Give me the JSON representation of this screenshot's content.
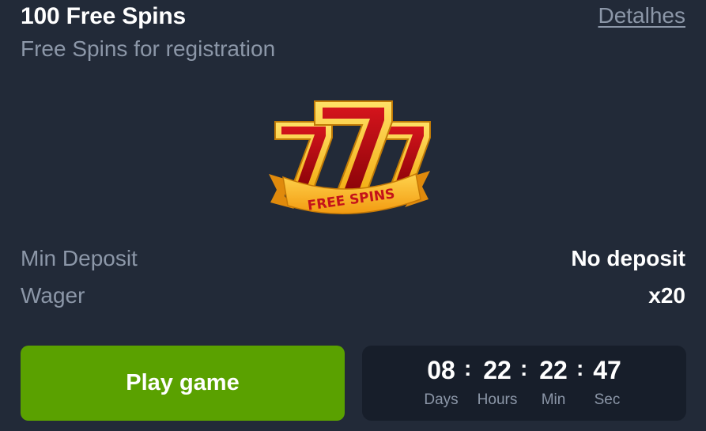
{
  "header": {
    "title": "100 Free Spins",
    "subtitle": "Free Spins for registration",
    "details_link": "Detalhes"
  },
  "logo": {
    "digits": "777",
    "ribbon_text": "FREE SPINS",
    "colors": {
      "gold": "#f7c51e",
      "red": "#b0080f",
      "dark_red": "#6e0205",
      "ribbon": "#f5a623",
      "ribbon_text": "#c4121a"
    }
  },
  "details": [
    {
      "label": "Min Deposit",
      "value": "No deposit"
    },
    {
      "label": "Wager",
      "value": "x20"
    }
  ],
  "play_button": {
    "label": "Play game",
    "color": "#5aa100"
  },
  "countdown": {
    "separator": ":",
    "units": [
      {
        "value": "08",
        "label": "Days"
      },
      {
        "value": "22",
        "label": "Hours"
      },
      {
        "value": "22",
        "label": "Min"
      },
      {
        "value": "47",
        "label": "Sec"
      }
    ]
  },
  "colors": {
    "background": "#222a38",
    "muted_text": "#8c97a8",
    "timer_background": "#171e2a"
  }
}
